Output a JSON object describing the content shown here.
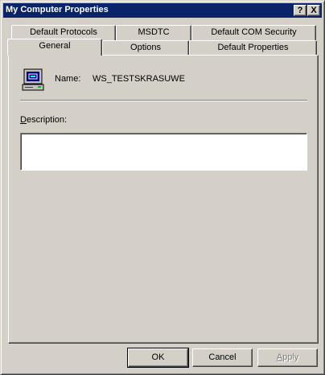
{
  "window": {
    "title": "My Computer Properties",
    "help_button": "?",
    "close_button": "X"
  },
  "tabs": {
    "back_row": [
      "Default Protocols",
      "MSDTC",
      "Default COM Security"
    ],
    "front_row": [
      "General",
      "Options",
      "Default Properties"
    ],
    "active": "General"
  },
  "general": {
    "icon": "computer-icon",
    "name_label": "Name:",
    "name_value": "WS_TESTSKRASUWE",
    "description_label_first": "D",
    "description_label_rest": "escription:",
    "description_value": ""
  },
  "buttons": {
    "ok": "OK",
    "cancel": "Cancel",
    "apply_first": "A",
    "apply_rest": "pply"
  },
  "colors": {
    "titlebar": "#0a246a",
    "face": "#d4d0c8"
  }
}
